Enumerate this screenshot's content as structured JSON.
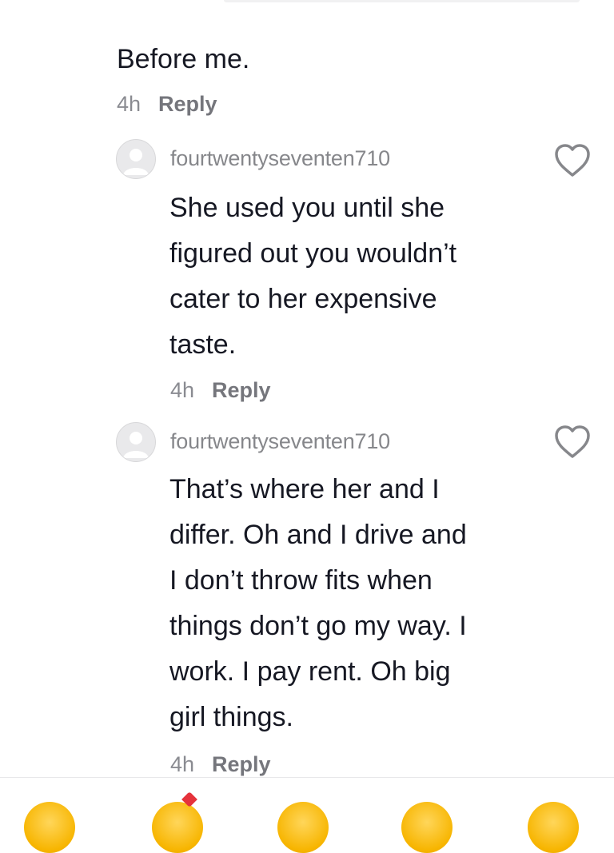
{
  "parent_comment": {
    "text": "Before me.",
    "time": "4h",
    "reply_label": "Reply"
  },
  "replies": [
    {
      "username": "fourtwentyseventen710",
      "lines": [
        "She used you until she",
        "figured out you wouldn’t",
        "cater to her expensive",
        "taste."
      ],
      "time": "4h",
      "reply_label": "Reply"
    },
    {
      "username": "fourtwentyseventen710",
      "lines": [
        "That’s where her and I",
        "differ. Oh and I drive and",
        "I don’t throw fits when",
        "things don’t go my way. I",
        "work. I pay rent. Oh big",
        "girl things."
      ],
      "time": "4h",
      "reply_label": "Reply"
    }
  ],
  "emoji_bar": {
    "icons": [
      "smiling-face-icon",
      "face-with-hearts-icon",
      "smiling-face-icon",
      "grinning-face-icon",
      "smiling-face-icon"
    ]
  },
  "colors": {
    "text": "#161823",
    "muted": "#86878b",
    "reply": "#75767c",
    "divider": "#e8e8ea",
    "emoji": "#f7b500"
  }
}
